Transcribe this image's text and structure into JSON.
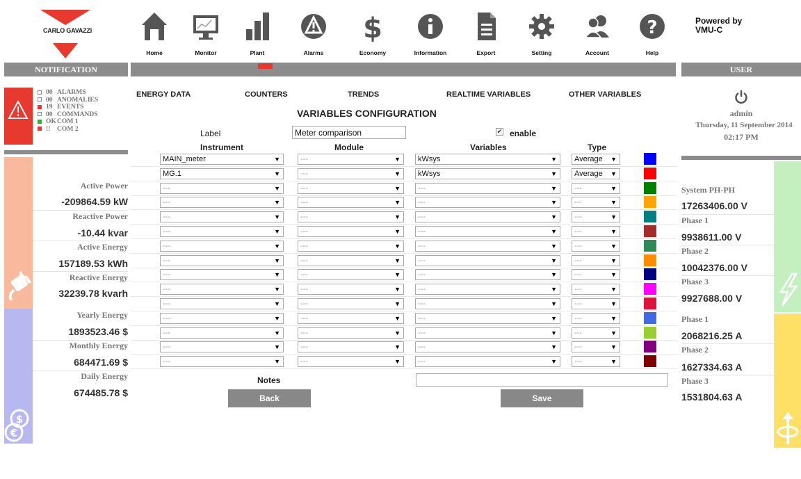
{
  "brand": {
    "name": "CARLO GAVAZZI",
    "powered_by": "Powered by\nVMU-C"
  },
  "nav": [
    {
      "id": "home",
      "label": "Home"
    },
    {
      "id": "monitor",
      "label": "Monitor"
    },
    {
      "id": "plant",
      "label": "Plant"
    },
    {
      "id": "alarms",
      "label": "Alarms"
    },
    {
      "id": "economy",
      "label": "Economy"
    },
    {
      "id": "information",
      "label": "Information"
    },
    {
      "id": "export",
      "label": "Export"
    },
    {
      "id": "setting",
      "label": "Setting"
    },
    {
      "id": "account",
      "label": "Account"
    },
    {
      "id": "help",
      "label": "Help"
    }
  ],
  "headers": {
    "notification": "NOTIFICATION",
    "user": "USER"
  },
  "notifications": [
    {
      "status": "",
      "count": "00",
      "label": "ALARMS",
      "color": "#ffffff"
    },
    {
      "status": "",
      "count": "00",
      "label": "ANOMALIES",
      "color": "#ffffff"
    },
    {
      "status": "",
      "count": "19",
      "label": "EVENTS",
      "color": "#e8392f"
    },
    {
      "status": "",
      "count": "00",
      "label": "COMMANDS",
      "color": "#ffffff"
    },
    {
      "status": "",
      "count": "OK",
      "label": "COM 1",
      "color": "#2cb52c"
    },
    {
      "status": "",
      "count": "!!",
      "label": "COM 2",
      "color": "#e8392f"
    }
  ],
  "power": {
    "active_power_label": "Active Power",
    "active_power": "-209864.59 kW",
    "reactive_power_label": "Reactive Power",
    "reactive_power": "-10.44 kvar",
    "active_energy_label": "Active Energy",
    "active_energy": "157189.53 kWh",
    "reactive_energy_label": "Reactive Energy",
    "reactive_energy": "32239.78 kvarh"
  },
  "economy": {
    "yearly_label": "Yearly Energy",
    "yearly": "1893523.46 $",
    "monthly_label": "Monthly Energy",
    "monthly": "684471.69 $",
    "daily_label": "Daily Energy",
    "daily": "674485.78 $"
  },
  "user": {
    "name": "admin",
    "date": "Thursday, 11 September 2014",
    "time": "02:17 PM"
  },
  "voltage": {
    "system_label": "System PH-PH",
    "system": "17263406.00 V",
    "p1_label": "Phase 1",
    "p1": "9938611.00 V",
    "p2_label": "Phase 2",
    "p2": "10042376.00 V",
    "p3_label": "Phase 3",
    "p3": "9927688.00 V"
  },
  "current": {
    "p1_label": "Phase 1",
    "p1": "2068216.25 A",
    "p2_label": "Phase 2",
    "p2": "1627334.63 A",
    "p3_label": "Phase 3",
    "p3": "1531804.63 A"
  },
  "tabs": [
    "ENERGY DATA",
    "COUNTERS",
    "TRENDS",
    "REALTIME VARIABLES",
    "OTHER VARIABLES"
  ],
  "form": {
    "title": "VARIABLES CONFIGURATION",
    "label_caption": "Label",
    "label_value": "Meter comparison",
    "enable_caption": "enable",
    "enabled": true,
    "columns": {
      "instrument": "Instrument",
      "module": "Module",
      "variables": "Variables",
      "type": "Type"
    },
    "notes_caption": "Notes",
    "notes_value": "",
    "back_label": "Back",
    "save_label": "Save"
  },
  "rows": [
    {
      "instrument": "MAIN_meter",
      "module": "---",
      "variable": "kWsys",
      "type": "Average",
      "color": "#0000ff"
    },
    {
      "instrument": "MG.1",
      "module": "---",
      "variable": "kWsys",
      "type": "Average",
      "color": "#ff0000"
    },
    {
      "instrument": "---",
      "module": "---",
      "variable": "---",
      "type": "---",
      "color": "#008000"
    },
    {
      "instrument": "---",
      "module": "---",
      "variable": "---",
      "type": "---",
      "color": "#ffa500"
    },
    {
      "instrument": "---",
      "module": "---",
      "variable": "---",
      "type": "---",
      "color": "#008080"
    },
    {
      "instrument": "---",
      "module": "---",
      "variable": "---",
      "type": "---",
      "color": "#a52a2a"
    },
    {
      "instrument": "---",
      "module": "---",
      "variable": "---",
      "type": "---",
      "color": "#2e8b57"
    },
    {
      "instrument": "---",
      "module": "---",
      "variable": "---",
      "type": "---",
      "color": "#ff8c00"
    },
    {
      "instrument": "---",
      "module": "---",
      "variable": "---",
      "type": "---",
      "color": "#000080"
    },
    {
      "instrument": "---",
      "module": "---",
      "variable": "---",
      "type": "---",
      "color": "#ff00ff"
    },
    {
      "instrument": "---",
      "module": "---",
      "variable": "---",
      "type": "---",
      "color": "#dc143c"
    },
    {
      "instrument": "---",
      "module": "---",
      "variable": "---",
      "type": "---",
      "color": "#4169e1"
    },
    {
      "instrument": "---",
      "module": "---",
      "variable": "---",
      "type": "---",
      "color": "#9acd32"
    },
    {
      "instrument": "---",
      "module": "---",
      "variable": "---",
      "type": "---",
      "color": "#800080"
    },
    {
      "instrument": "---",
      "module": "---",
      "variable": "---",
      "type": "---",
      "color": "#800000"
    }
  ]
}
